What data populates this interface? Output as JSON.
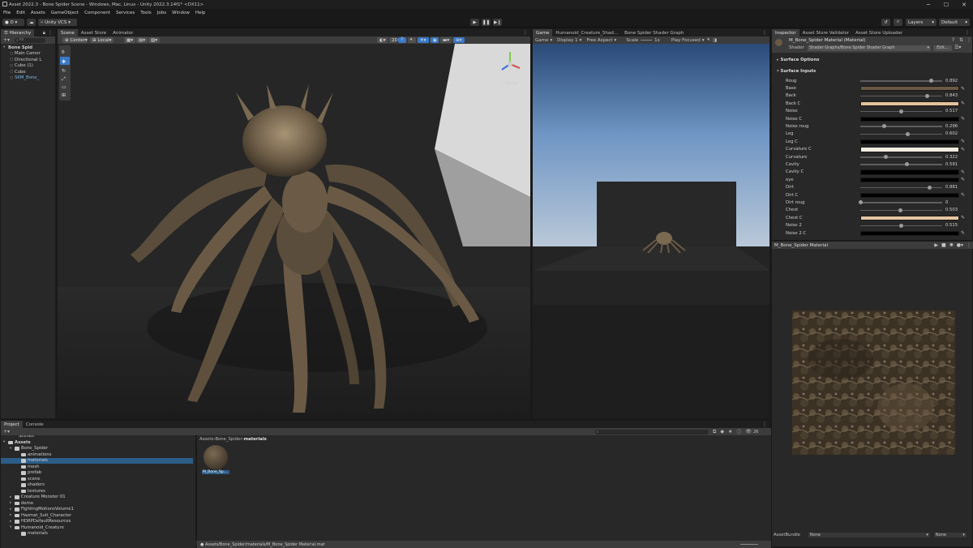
{
  "window": {
    "title": "Asset 2022.3 - Bone Spider Scene - Windows, Mac, Linux - Unity 2022.3.14f1* <DX11>"
  },
  "menu": [
    "File",
    "Edit",
    "Assets",
    "GameObject",
    "Component",
    "Services",
    "Tools",
    "Jobs",
    "Window",
    "Help"
  ],
  "toolbar": {
    "account": "D",
    "vcs": "Unity VCS",
    "layers": "Layers",
    "layout": "Default"
  },
  "hierarchy": {
    "tab": "Hierarchy",
    "search_placeholder": "All",
    "items": [
      {
        "label": "Bone Spid",
        "depth": 0
      },
      {
        "label": "Main Camer",
        "depth": 1
      },
      {
        "label": "Directional L",
        "depth": 1
      },
      {
        "label": "Cube (1)",
        "depth": 1
      },
      {
        "label": "Cube",
        "depth": 1
      },
      {
        "label": "SKM_Bone_",
        "depth": 1
      }
    ]
  },
  "scene": {
    "tabs": [
      "Scene",
      "Asset Store",
      "Animator"
    ],
    "pivot": "Center",
    "space": "Local",
    "persp_label": "< Persp"
  },
  "game": {
    "tabs": [
      "Game",
      "Humanoid_Creature_Shad...",
      "Bone Spider Shader Graph"
    ],
    "mode": "Game",
    "display": "Display 1",
    "aspect": "Free Aspect",
    "scale_label": "Scale",
    "scale_value": "1x",
    "play_mode": "Play Focused"
  },
  "inspector": {
    "tabs": [
      "Inspector",
      "Asset Store Validator",
      "Asset Store Uploader"
    ],
    "material_name": "M_Bone_Spider Material (Material)",
    "shader_label": "Shader",
    "shader_value": "Shader Graphs/Bone Spider Shader Graph",
    "edit_label": "Edit...",
    "surface_options": "Surface Options",
    "surface_inputs": "Surface Inputs",
    "properties": [
      {
        "label": "Roug",
        "type": "slider",
        "value": "0.892",
        "fraction": 0.892
      },
      {
        "label": "Base",
        "type": "color",
        "color": "#6b5a44"
      },
      {
        "label": "Back",
        "type": "slider",
        "value": "0.843",
        "fraction": 0.843
      },
      {
        "label": "Back C",
        "type": "color",
        "color": "#e5c29a"
      },
      {
        "label": "Noise",
        "type": "slider",
        "value": "0.517",
        "fraction": 0.517
      },
      {
        "label": "Noise C",
        "type": "color",
        "color": "#000000"
      },
      {
        "label": "Noise roug",
        "type": "slider",
        "value": "0.296",
        "fraction": 0.296
      },
      {
        "label": "Leg",
        "type": "slider",
        "value": "0.602",
        "fraction": 0.602
      },
      {
        "label": "Leg C",
        "type": "color",
        "color": "#000000"
      },
      {
        "label": "Curvature C",
        "type": "color",
        "color": "#f3ece0"
      },
      {
        "label": "Curvature",
        "type": "slider",
        "value": "0.322",
        "fraction": 0.322
      },
      {
        "label": "Cavity",
        "type": "slider",
        "value": "0.591",
        "fraction": 0.591
      },
      {
        "label": "Cavity C",
        "type": "color",
        "color": "#000000"
      },
      {
        "label": "eye",
        "type": "color",
        "color": "#000000"
      },
      {
        "label": "Dirt",
        "type": "slider",
        "value": "0.881",
        "fraction": 0.881
      },
      {
        "label": "Dirt C",
        "type": "color",
        "color": "#000000"
      },
      {
        "label": "Dirt roug",
        "type": "slider",
        "value": "0",
        "fraction": 0.0
      },
      {
        "label": "Chest",
        "type": "slider",
        "value": "0.503",
        "fraction": 0.503
      },
      {
        "label": "Chest C",
        "type": "color",
        "color": "#e6c5a0"
      },
      {
        "label": "Noise 2",
        "type": "slider",
        "value": "0.515",
        "fraction": 0.515
      },
      {
        "label": "Noise 2 C",
        "type": "color",
        "color": "#000000"
      }
    ],
    "preview_title": "M_Bone_Spider Material",
    "assetbundle_label": "AssetBundle",
    "assetbundle_value": "None",
    "variant_value": "None"
  },
  "project": {
    "tabs": [
      "Project",
      "Console"
    ],
    "top_cut": "Scenes",
    "tree": [
      {
        "label": "Assets",
        "depth": 0,
        "open": true
      },
      {
        "label": "Bone_Spider",
        "depth": 1,
        "open": true
      },
      {
        "label": "animations",
        "depth": 2
      },
      {
        "label": "materials",
        "depth": 2,
        "selected": true
      },
      {
        "label": "mesh",
        "depth": 2
      },
      {
        "label": "prefab",
        "depth": 2
      },
      {
        "label": "scene",
        "depth": 2
      },
      {
        "label": "shaders",
        "depth": 2
      },
      {
        "label": "textures",
        "depth": 2
      },
      {
        "label": "Creature Monster 01",
        "depth": 1
      },
      {
        "label": "demo",
        "depth": 1
      },
      {
        "label": "FightingMotionsVolume1",
        "depth": 1
      },
      {
        "label": "Hazmat_Suit_Character",
        "depth": 1
      },
      {
        "label": "HDRPDefaultResources",
        "depth": 1
      },
      {
        "label": "Humanoid_Creature",
        "depth": 1,
        "open": true
      },
      {
        "label": "materials",
        "depth": 2
      }
    ],
    "breadcrumb": [
      "Assets",
      "Bone_Spider",
      "materials"
    ],
    "asset_name": "M_Bone_Sp...",
    "hidden_count": "26",
    "status_path": "Assets/Bone_Spider/materials/M_Bone_Spider Material.mat"
  },
  "colors": {
    "panel": "#282828",
    "tab_active": "#3c3c3c",
    "selection": "#2c5d87",
    "accent_blue": "#3a79c7"
  }
}
